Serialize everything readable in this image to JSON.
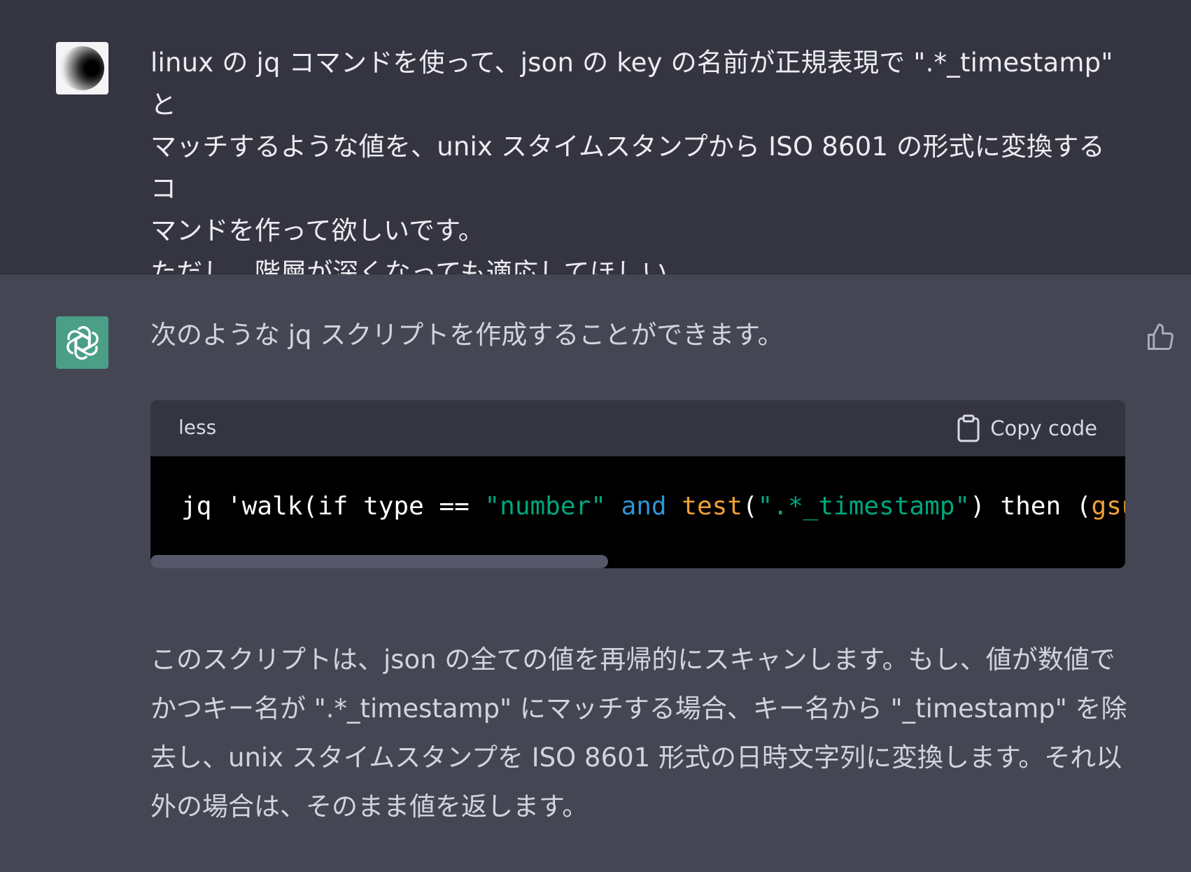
{
  "user_message": {
    "lines": [
      "linux の jq コマンドを使って、json の key の名前が正規表現で \".*_timestamp\" と",
      "マッチするような値を、unix スタイムスタンプから ISO 8601 の形式に変換するコ",
      "マンドを作って欲しいです。",
      "ただし、階層が深くなっても適応してほしい。"
    ]
  },
  "assistant_message": {
    "intro": "次のような jq スクリプトを作成することができます。",
    "code_block": {
      "language": "less",
      "copy_label": "Copy code",
      "tokens": [
        {
          "text": "jq 'walk(if type == ",
          "kind": "plain"
        },
        {
          "text": "\"number\"",
          "kind": "str"
        },
        {
          "text": " ",
          "kind": "plain"
        },
        {
          "text": "and",
          "kind": "kw"
        },
        {
          "text": " ",
          "kind": "plain"
        },
        {
          "text": "test",
          "kind": "fn"
        },
        {
          "text": "(",
          "kind": "plain"
        },
        {
          "text": "\".*_timestamp\"",
          "kind": "str"
        },
        {
          "text": ") then (",
          "kind": "plain"
        },
        {
          "text": "gsub(",
          "kind": "fn"
        }
      ],
      "scroll_position": 0.47
    },
    "paragraph_lines": [
      "このスクリプトは、json の全ての値を再帰的にスキャンします。もし、値が数値で",
      "かつキー名が \".*_timestamp\" にマッチする場合、キー名から \"_timestamp\" を除",
      "去し、unix スタイムスタンプを ISO 8601 形式の日時文字列に変換します。それ以",
      "外の場合は、そのまま値を返します。"
    ]
  },
  "icons": {
    "user_avatar": "user-avatar-image",
    "bot_avatar": "openai-logo-icon",
    "thumbs_up": "thumbs-up-icon",
    "copy": "clipboard-icon"
  },
  "colors": {
    "user_bg": "#343541",
    "assistant_bg": "#444654",
    "bot_avatar_bg": "#4a9f86",
    "code_string": "#00a67d",
    "code_keyword": "#2e95d3",
    "code_function": "#f0a035"
  }
}
